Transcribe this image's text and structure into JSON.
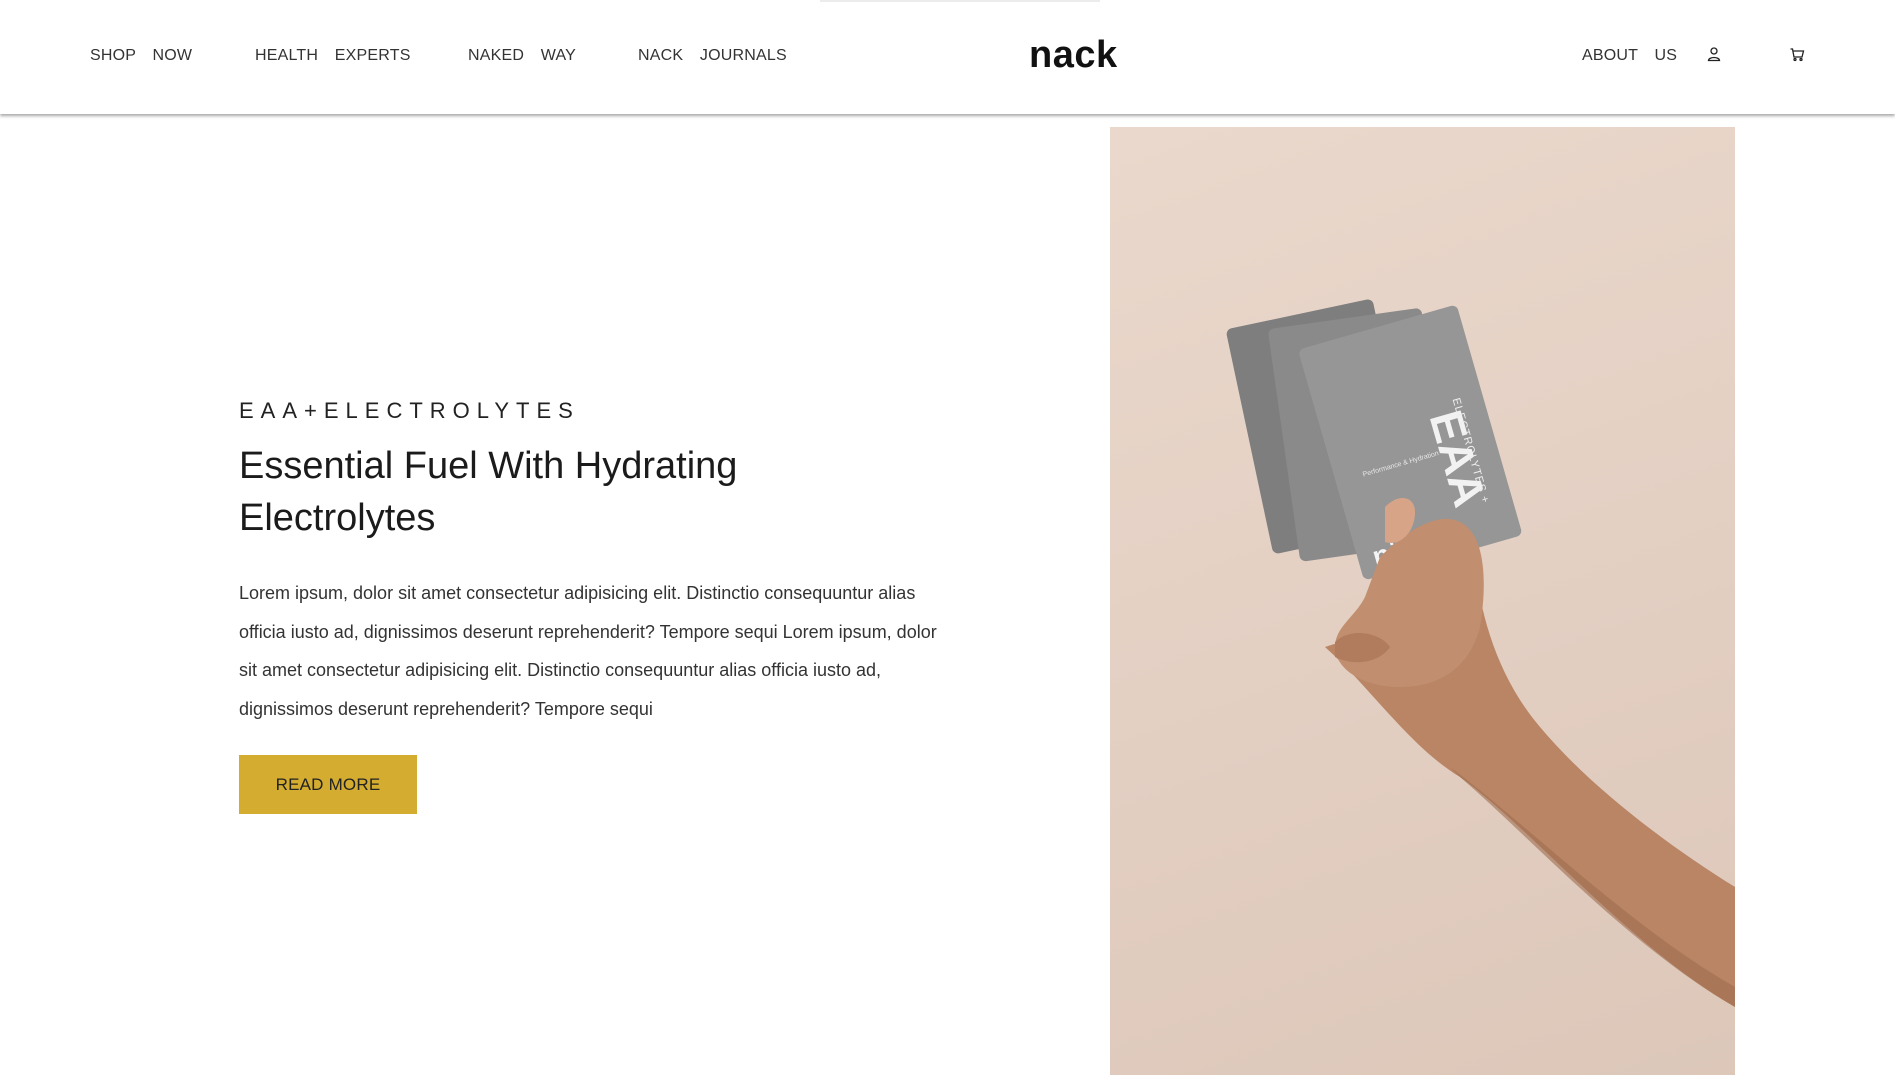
{
  "nav": {
    "left_items": [
      {
        "label": "SHOP NOW"
      },
      {
        "label": "HEALTH EXPERTS"
      },
      {
        "label": "NAKED WAY"
      },
      {
        "label": "NACK JOURNALS"
      }
    ],
    "brand": "nack",
    "right_items": [
      {
        "label": "ABOUT US"
      }
    ],
    "icons": [
      "user-icon",
      "cart-icon"
    ]
  },
  "hero": {
    "eyebrow": "EAA+ELECTROLYTES",
    "headline": "Essential Fuel With Hydrating Electrolytes",
    "body": "Lorem ipsum, dolor sit amet consectetur adipisicing elit. Distinctio consequuntur alias officia iusto ad, dignissimos deserunt reprehenderit? Tempore sequi Lorem ipsum, dolor sit amet consectetur adipisicing elit. Distinctio consequuntur alias officia iusto ad, dignissimos deserunt reprehenderit? Tempore sequi",
    "cta_label": "READ MORE"
  },
  "product_image": {
    "packet_brand": "näck",
    "packet_title": "EAA",
    "packet_subtitle": "ELECTROLYTES +",
    "packet_tagline": "Performance & Hydration"
  },
  "colors": {
    "accent": "#d4ad30",
    "photo_background": "#e6d3c7",
    "packet": "#8f8f8f"
  }
}
